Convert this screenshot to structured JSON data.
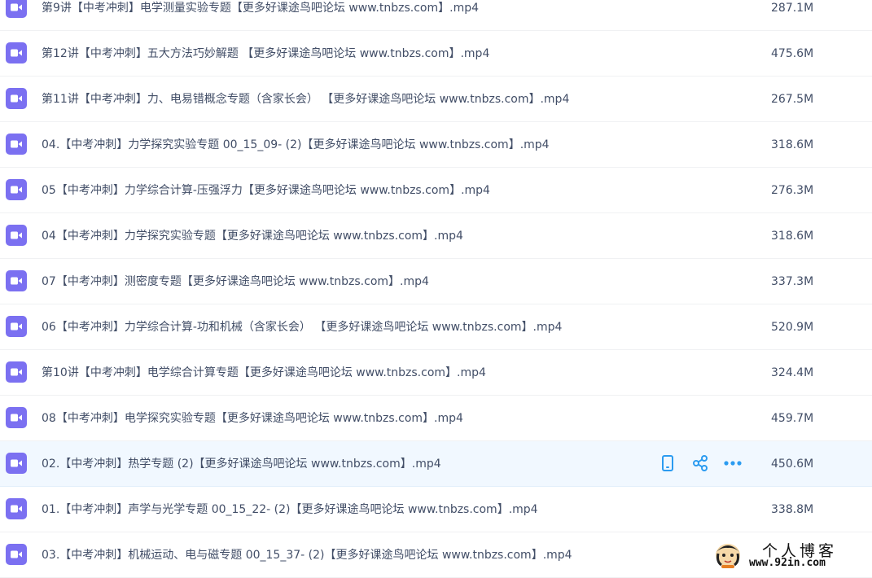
{
  "files": [
    {
      "name": "第9讲【中考冲刺】电学测量实验专题【更多好课途鸟吧论坛 www.tnbzs.com】.mp4",
      "size": "287.1M"
    },
    {
      "name": "第12讲【中考冲刺】五大方法巧妙解题 【更多好课途鸟吧论坛 www.tnbzs.com】.mp4",
      "size": "475.6M"
    },
    {
      "name": "第11讲【中考冲刺】力、电易错概念专题（含家长会） 【更多好课途鸟吧论坛 www.tnbzs.com】.mp4",
      "size": "267.5M"
    },
    {
      "name": "04.【中考冲刺】力学探究实验专题 00_15_09- (2)【更多好课途鸟吧论坛 www.tnbzs.com】.mp4",
      "size": "318.6M"
    },
    {
      "name": "05【中考冲刺】力学综合计算-压强浮力【更多好课途鸟吧论坛 www.tnbzs.com】.mp4",
      "size": "276.3M"
    },
    {
      "name": "04【中考冲刺】力学探究实验专题【更多好课途鸟吧论坛 www.tnbzs.com】.mp4",
      "size": "318.6M"
    },
    {
      "name": "07【中考冲刺】测密度专题【更多好课途鸟吧论坛 www.tnbzs.com】.mp4",
      "size": "337.3M"
    },
    {
      "name": "06【中考冲刺】力学综合计算-功和机械（含家长会） 【更多好课途鸟吧论坛 www.tnbzs.com】.mp4",
      "size": "520.9M"
    },
    {
      "name": "第10讲【中考冲刺】电学综合计算专题【更多好课途鸟吧论坛 www.tnbzs.com】.mp4",
      "size": "324.4M"
    },
    {
      "name": "08【中考冲刺】电学探究实验专题【更多好课途鸟吧论坛 www.tnbzs.com】.mp4",
      "size": "459.7M"
    },
    {
      "name": "02.【中考冲刺】热学专题 (2)【更多好课途鸟吧论坛 www.tnbzs.com】.mp4",
      "size": "450.6M"
    },
    {
      "name": "01.【中考冲刺】声学与光学专题 00_15_22- (2)【更多好课途鸟吧论坛 www.tnbzs.com】.mp4",
      "size": "338.8M"
    },
    {
      "name": "03.【中考冲刺】机械运动、电与磁专题 00_15_37- (2)【更多好课途鸟吧论坛 www.tnbzs.com】.mp4",
      "size": ""
    }
  ],
  "hovered_row_index": 10,
  "row_actions": [
    {
      "name": "phone-icon"
    },
    {
      "name": "share-icon"
    },
    {
      "name": "more-icon"
    }
  ],
  "watermark": {
    "title": "个人博客",
    "url": "www.92in.com"
  },
  "colors": {
    "icon_bg": "#7b70f1",
    "action_blue": "#2b9bf0",
    "text": "#424e67",
    "hover_bg": "#f1f8ff"
  }
}
